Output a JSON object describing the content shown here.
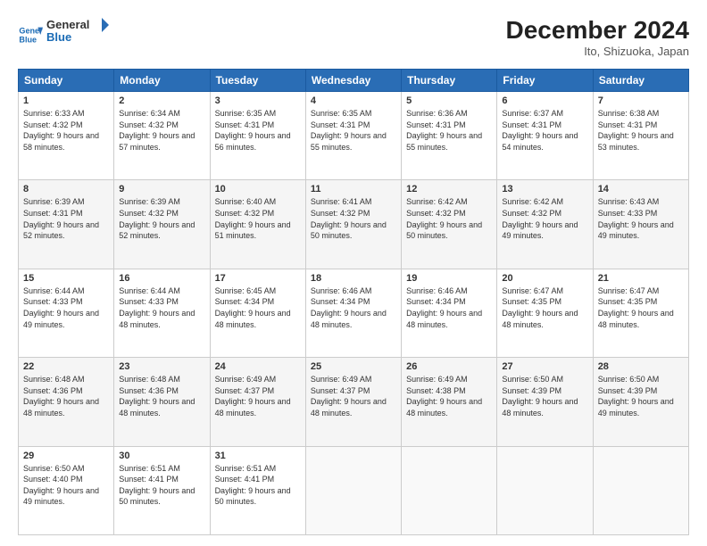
{
  "header": {
    "logo_line1": "General",
    "logo_line2": "Blue",
    "main_title": "December 2024",
    "subtitle": "Ito, Shizuoka, Japan"
  },
  "weekdays": [
    "Sunday",
    "Monday",
    "Tuesday",
    "Wednesday",
    "Thursday",
    "Friday",
    "Saturday"
  ],
  "weeks": [
    [
      {
        "day": "1",
        "sunrise": "6:33 AM",
        "sunset": "4:32 PM",
        "daylight": "9 hours and 58 minutes."
      },
      {
        "day": "2",
        "sunrise": "6:34 AM",
        "sunset": "4:32 PM",
        "daylight": "9 hours and 57 minutes."
      },
      {
        "day": "3",
        "sunrise": "6:35 AM",
        "sunset": "4:31 PM",
        "daylight": "9 hours and 56 minutes."
      },
      {
        "day": "4",
        "sunrise": "6:35 AM",
        "sunset": "4:31 PM",
        "daylight": "9 hours and 55 minutes."
      },
      {
        "day": "5",
        "sunrise": "6:36 AM",
        "sunset": "4:31 PM",
        "daylight": "9 hours and 55 minutes."
      },
      {
        "day": "6",
        "sunrise": "6:37 AM",
        "sunset": "4:31 PM",
        "daylight": "9 hours and 54 minutes."
      },
      {
        "day": "7",
        "sunrise": "6:38 AM",
        "sunset": "4:31 PM",
        "daylight": "9 hours and 53 minutes."
      }
    ],
    [
      {
        "day": "8",
        "sunrise": "6:39 AM",
        "sunset": "4:31 PM",
        "daylight": "9 hours and 52 minutes."
      },
      {
        "day": "9",
        "sunrise": "6:39 AM",
        "sunset": "4:32 PM",
        "daylight": "9 hours and 52 minutes."
      },
      {
        "day": "10",
        "sunrise": "6:40 AM",
        "sunset": "4:32 PM",
        "daylight": "9 hours and 51 minutes."
      },
      {
        "day": "11",
        "sunrise": "6:41 AM",
        "sunset": "4:32 PM",
        "daylight": "9 hours and 50 minutes."
      },
      {
        "day": "12",
        "sunrise": "6:42 AM",
        "sunset": "4:32 PM",
        "daylight": "9 hours and 50 minutes."
      },
      {
        "day": "13",
        "sunrise": "6:42 AM",
        "sunset": "4:32 PM",
        "daylight": "9 hours and 49 minutes."
      },
      {
        "day": "14",
        "sunrise": "6:43 AM",
        "sunset": "4:33 PM",
        "daylight": "9 hours and 49 minutes."
      }
    ],
    [
      {
        "day": "15",
        "sunrise": "6:44 AM",
        "sunset": "4:33 PM",
        "daylight": "9 hours and 49 minutes."
      },
      {
        "day": "16",
        "sunrise": "6:44 AM",
        "sunset": "4:33 PM",
        "daylight": "9 hours and 48 minutes."
      },
      {
        "day": "17",
        "sunrise": "6:45 AM",
        "sunset": "4:34 PM",
        "daylight": "9 hours and 48 minutes."
      },
      {
        "day": "18",
        "sunrise": "6:46 AM",
        "sunset": "4:34 PM",
        "daylight": "9 hours and 48 minutes."
      },
      {
        "day": "19",
        "sunrise": "6:46 AM",
        "sunset": "4:34 PM",
        "daylight": "9 hours and 48 minutes."
      },
      {
        "day": "20",
        "sunrise": "6:47 AM",
        "sunset": "4:35 PM",
        "daylight": "9 hours and 48 minutes."
      },
      {
        "day": "21",
        "sunrise": "6:47 AM",
        "sunset": "4:35 PM",
        "daylight": "9 hours and 48 minutes."
      }
    ],
    [
      {
        "day": "22",
        "sunrise": "6:48 AM",
        "sunset": "4:36 PM",
        "daylight": "9 hours and 48 minutes."
      },
      {
        "day": "23",
        "sunrise": "6:48 AM",
        "sunset": "4:36 PM",
        "daylight": "9 hours and 48 minutes."
      },
      {
        "day": "24",
        "sunrise": "6:49 AM",
        "sunset": "4:37 PM",
        "daylight": "9 hours and 48 minutes."
      },
      {
        "day": "25",
        "sunrise": "6:49 AM",
        "sunset": "4:37 PM",
        "daylight": "9 hours and 48 minutes."
      },
      {
        "day": "26",
        "sunrise": "6:49 AM",
        "sunset": "4:38 PM",
        "daylight": "9 hours and 48 minutes."
      },
      {
        "day": "27",
        "sunrise": "6:50 AM",
        "sunset": "4:39 PM",
        "daylight": "9 hours and 48 minutes."
      },
      {
        "day": "28",
        "sunrise": "6:50 AM",
        "sunset": "4:39 PM",
        "daylight": "9 hours and 49 minutes."
      }
    ],
    [
      {
        "day": "29",
        "sunrise": "6:50 AM",
        "sunset": "4:40 PM",
        "daylight": "9 hours and 49 minutes."
      },
      {
        "day": "30",
        "sunrise": "6:51 AM",
        "sunset": "4:41 PM",
        "daylight": "9 hours and 50 minutes."
      },
      {
        "day": "31",
        "sunrise": "6:51 AM",
        "sunset": "4:41 PM",
        "daylight": "9 hours and 50 minutes."
      },
      null,
      null,
      null,
      null
    ]
  ]
}
